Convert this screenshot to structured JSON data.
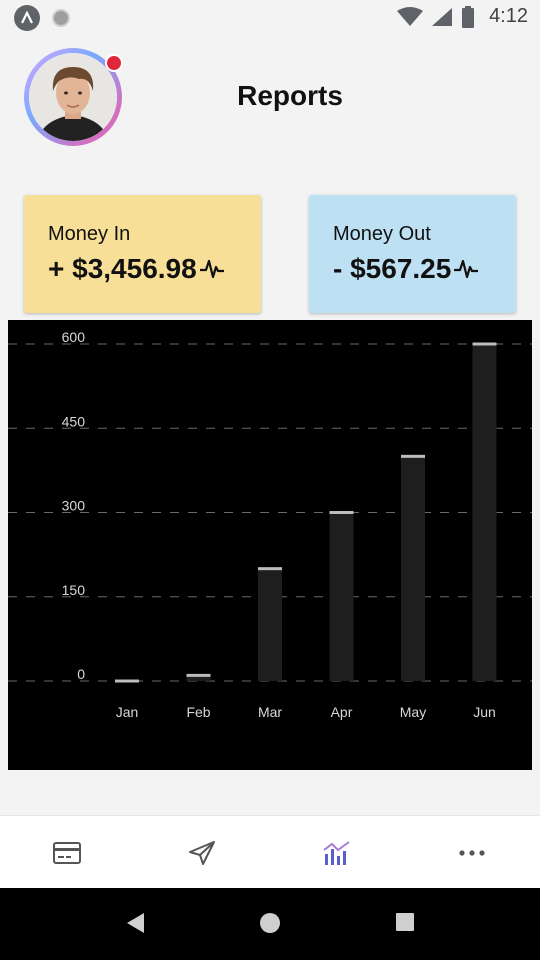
{
  "status_bar": {
    "time": "4:12",
    "icons": [
      "app-logo-icon",
      "circle-notification-icon",
      "wifi-icon",
      "signal-icon",
      "battery-icon"
    ]
  },
  "header": {
    "title": "Reports",
    "avatar": "user-avatar",
    "has_notification": true
  },
  "cards": {
    "money_in": {
      "label": "Money In",
      "value": "+ $3,456.98",
      "icon": "pulse-icon",
      "color": "#f7df97"
    },
    "money_out": {
      "label": "Money Out",
      "value": "- $567.25",
      "icon": "pulse-icon",
      "color": "#bde0f2"
    }
  },
  "chart_data": {
    "type": "bar",
    "categories": [
      "Jan",
      "Feb",
      "Mar",
      "Apr",
      "May",
      "Jun"
    ],
    "values": [
      0,
      10,
      200,
      300,
      400,
      600
    ],
    "yticks": [
      0,
      150,
      300,
      450,
      600
    ],
    "ylim": [
      0,
      600
    ],
    "title": "",
    "xlabel": "",
    "ylabel": "",
    "grid": true,
    "bar_color": "#1e1e1e",
    "background": "#000000"
  },
  "tab_bar": {
    "tabs": [
      {
        "name": "cards",
        "icon": "credit-card-icon",
        "active": false
      },
      {
        "name": "send",
        "icon": "paper-plane-icon",
        "active": false
      },
      {
        "name": "reports",
        "icon": "chart-icon",
        "active": true
      },
      {
        "name": "more",
        "icon": "more-dots-icon",
        "active": false
      }
    ],
    "active_color": "#5a5fcf"
  },
  "nav_bar": {
    "buttons": [
      "back-icon",
      "home-icon",
      "recents-icon"
    ]
  }
}
